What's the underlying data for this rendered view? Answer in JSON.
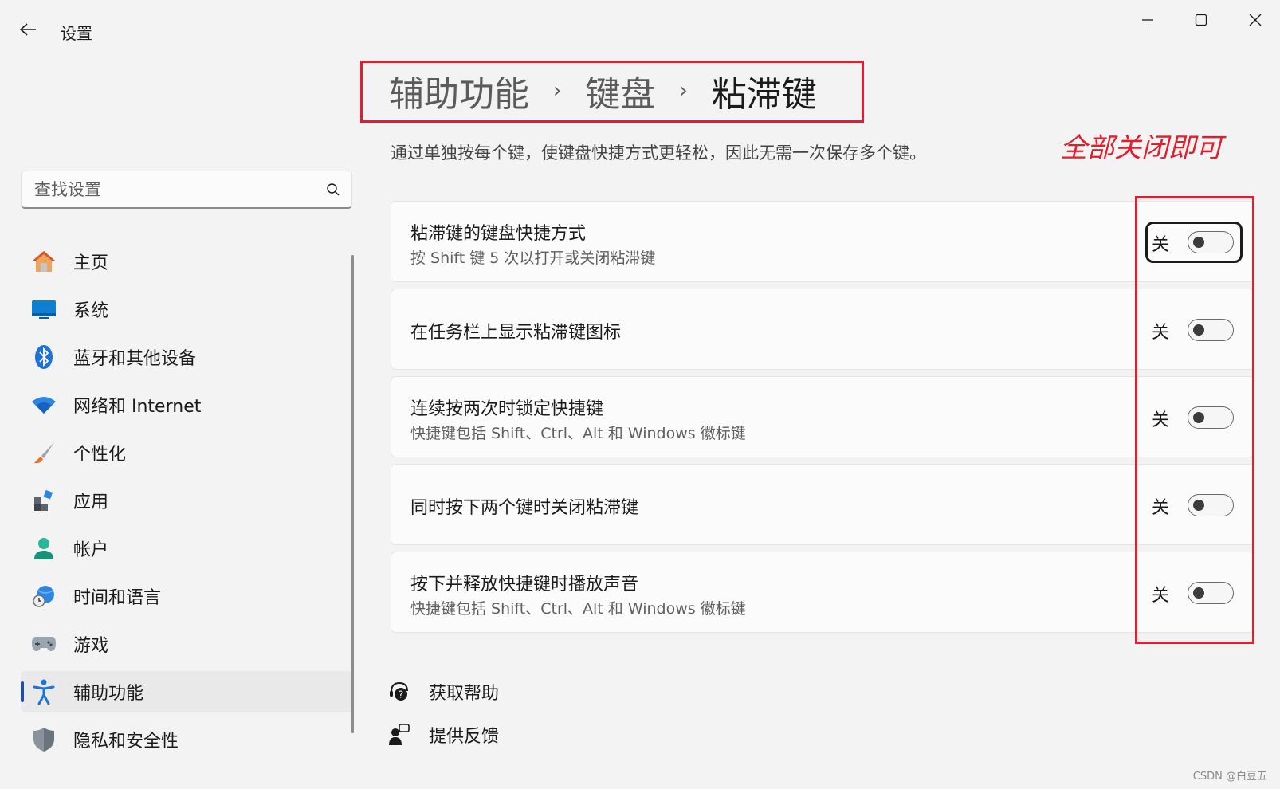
{
  "titlebar": {
    "title": "设置"
  },
  "search": {
    "placeholder": "查找设置"
  },
  "sidebar": {
    "items": [
      {
        "label": "主页",
        "icon": "home-icon"
      },
      {
        "label": "系统",
        "icon": "system-icon"
      },
      {
        "label": "蓝牙和其他设备",
        "icon": "bluetooth-icon"
      },
      {
        "label": "网络和 Internet",
        "icon": "wifi-icon"
      },
      {
        "label": "个性化",
        "icon": "brush-icon"
      },
      {
        "label": "应用",
        "icon": "apps-icon"
      },
      {
        "label": "帐户",
        "icon": "account-icon"
      },
      {
        "label": "时间和语言",
        "icon": "globe-clock-icon"
      },
      {
        "label": "游戏",
        "icon": "gamepad-icon"
      },
      {
        "label": "辅助功能",
        "icon": "accessibility-icon",
        "active": true
      },
      {
        "label": "隐私和安全性",
        "icon": "shield-icon"
      }
    ]
  },
  "breadcrumb": {
    "items": [
      "辅助功能",
      "键盘",
      "粘滞键"
    ],
    "separator": "›"
  },
  "description": "通过单独按每个键，使键盘快捷方式更轻松，因此无需一次保存多个键。",
  "annotation": "全部关闭即可",
  "settings": [
    {
      "title": "粘滞键的键盘快捷方式",
      "subtitle": "按 Shift 键 5 次以打开或关闭粘滞键",
      "state": "关"
    },
    {
      "title": "在任务栏上显示粘滞键图标",
      "subtitle": "",
      "state": "关"
    },
    {
      "title": "连续按两次时锁定快捷键",
      "subtitle": "快捷键包括 Shift、Ctrl、Alt 和 Windows 徽标键",
      "state": "关"
    },
    {
      "title": "同时按下两个键时关闭粘滞键",
      "subtitle": "",
      "state": "关"
    },
    {
      "title": "按下并释放快捷键时播放声音",
      "subtitle": "快捷键包括 Shift、Ctrl、Alt 和 Windows 徽标键",
      "state": "关"
    }
  ],
  "links": {
    "help": "获取帮助",
    "feedback": "提供反馈"
  },
  "watermark": "CSDN @白豆五",
  "colors": {
    "accent": "#1f4ea0",
    "annotation_red": "#e01f2e",
    "background": "#f3f3f3"
  }
}
